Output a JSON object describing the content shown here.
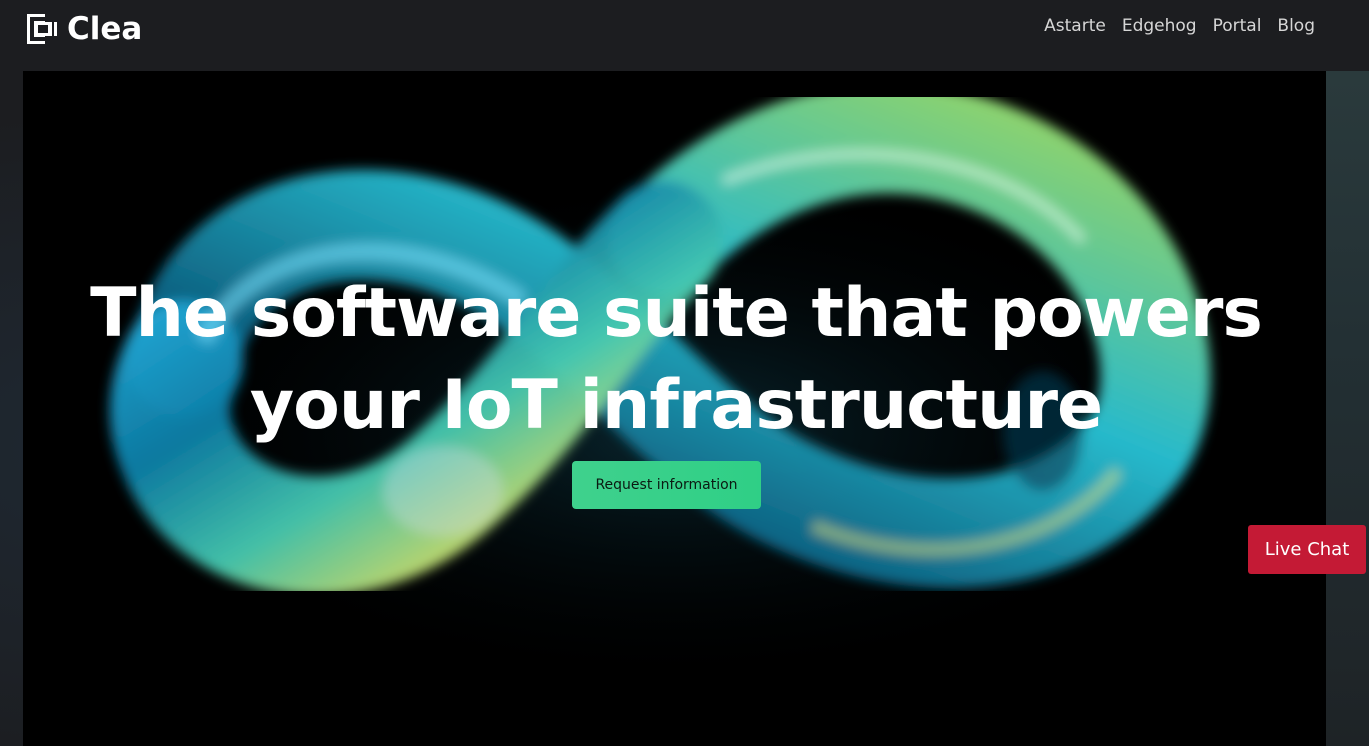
{
  "brand": {
    "name": "Clea",
    "logo_icon": "clea-logo-icon"
  },
  "nav": {
    "items": [
      {
        "label": "Astarte"
      },
      {
        "label": "Edgehog"
      },
      {
        "label": "Portal"
      },
      {
        "label": "Blog"
      }
    ]
  },
  "hero": {
    "headline_line1": "The software suite that powers",
    "headline_line2": "your IoT infrastructure",
    "cta_label": "Request information",
    "art": "infinity-loop-illustration"
  },
  "chat": {
    "label": "Live Chat"
  },
  "colors": {
    "background": "#1c1d20",
    "hero_background": "#000000",
    "cta_green": "#3fd18d",
    "chat_red": "#c41a35",
    "text": "#ffffff"
  }
}
